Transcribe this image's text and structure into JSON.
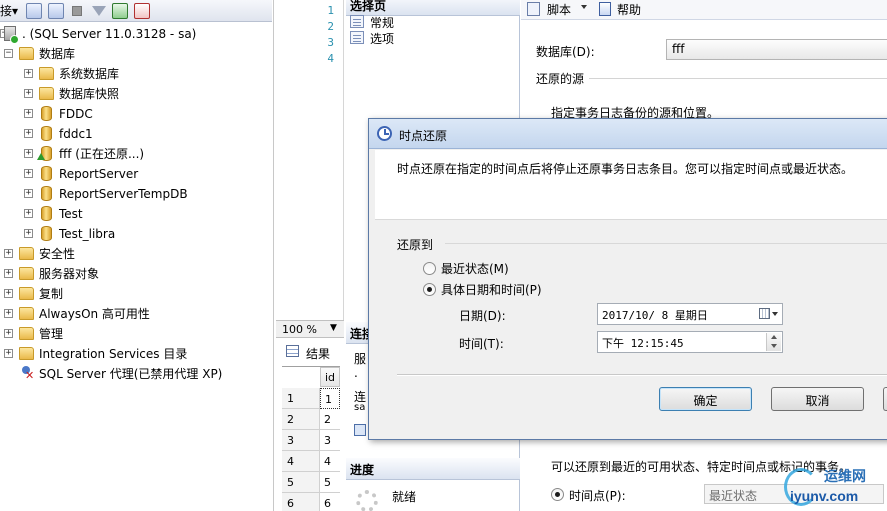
{
  "explorer": {
    "toolbar": {
      "connect_label": "接▾"
    },
    "tree": [
      {
        "id": "server",
        "label": ". (SQL Server 11.0.3128 - sa)",
        "icon": "server-icon",
        "expander": "-",
        "level": 0
      },
      {
        "id": "databases",
        "label": "数据库",
        "icon": "folder-icon",
        "expander": "-",
        "level": 1
      },
      {
        "id": "system-databases",
        "label": "系统数据库",
        "icon": "folder-icon",
        "expander": "+",
        "level": 2
      },
      {
        "id": "database-snapshots",
        "label": "数据库快照",
        "icon": "folder-icon",
        "expander": "+",
        "level": 2
      },
      {
        "id": "db-fddc-upper",
        "label": "FDDC",
        "icon": "db-icon",
        "expander": "+",
        "level": 2
      },
      {
        "id": "db-fddc1",
        "label": "fddc1",
        "icon": "db-icon",
        "expander": "+",
        "level": 2
      },
      {
        "id": "db-fff",
        "label": "fff (正在还原...)",
        "icon": "db-restoring-icon",
        "expander": "+",
        "level": 2
      },
      {
        "id": "db-reportserver",
        "label": "ReportServer",
        "icon": "db-icon",
        "expander": "+",
        "level": 2
      },
      {
        "id": "db-reportservertempdb",
        "label": "ReportServerTempDB",
        "icon": "db-icon",
        "expander": "+",
        "level": 2
      },
      {
        "id": "db-test",
        "label": "Test",
        "icon": "db-icon",
        "expander": "+",
        "level": 2
      },
      {
        "id": "db-test-libra",
        "label": "Test_libra",
        "icon": "db-icon",
        "expander": "+",
        "level": 2
      },
      {
        "id": "security",
        "label": "安全性",
        "icon": "folder-icon",
        "expander": "+",
        "level": 1
      },
      {
        "id": "server-objects",
        "label": "服务器对象",
        "icon": "folder-icon",
        "expander": "+",
        "level": 1
      },
      {
        "id": "replication",
        "label": "复制",
        "icon": "folder-icon",
        "expander": "+",
        "level": 1
      },
      {
        "id": "alwayson",
        "label": "AlwaysOn 高可用性",
        "icon": "folder-icon",
        "expander": "+",
        "level": 1
      },
      {
        "id": "management",
        "label": "管理",
        "icon": "folder-icon",
        "expander": "+",
        "level": 1
      },
      {
        "id": "integration-services",
        "label": "Integration Services 目录",
        "icon": "folder-icon",
        "expander": "+",
        "level": 1
      },
      {
        "id": "sql-agent",
        "label": "SQL Server 代理(已禁用代理 XP)",
        "icon": "agent-icon",
        "expander": "",
        "level": 1
      }
    ]
  },
  "editor": {
    "line_numbers": [
      "1",
      "2",
      "3",
      "4"
    ],
    "zoom": "100 %",
    "results_tab": "结果",
    "grid": {
      "column_header": "id",
      "row_numbers": [
        "1",
        "2",
        "3",
        "4",
        "5",
        "6"
      ],
      "cells": [
        "1",
        "2",
        "3",
        "4",
        "5",
        "6"
      ]
    }
  },
  "restore_dialog": {
    "select_page_header": "选择页",
    "pages": [
      "常规",
      "选项"
    ],
    "connection_header": "连接",
    "connection_server_label": "服",
    "connection_server_value": ".",
    "connection_label": "连",
    "connection_value": "sa",
    "progress_header": "进度",
    "progress_status": "就绪",
    "toolbar_script": "脚本",
    "toolbar_help": "帮助",
    "database_label": "数据库(D):",
    "database_value": "fff",
    "source_section": "还原的源",
    "source_hint": "指定事务日志备份的源和位置。",
    "restore_hint": "可以还原到最近的可用状态、特定时间点或标记的事务。",
    "point_in_time_label": "时间点(P):",
    "point_in_time_value": "最近状态"
  },
  "modal": {
    "title": "时点还原",
    "description": "时点还原在指定的时间点后将停止还原事务日志条目。您可以指定时间点或最近状态。",
    "restore_to": "还原到",
    "option_latest": "最近状态(M)",
    "option_specific": "具体日期和时间(P)",
    "selected_option": "specific",
    "date_label": "日期(D):",
    "date_value": "2017/10/ 8 星期日",
    "time_label": "时间(T):",
    "time_value": "下午 12:15:45",
    "ok": "确定",
    "cancel": "取消"
  },
  "watermark": {
    "name": "运维网",
    "url": "iyunv.com"
  }
}
